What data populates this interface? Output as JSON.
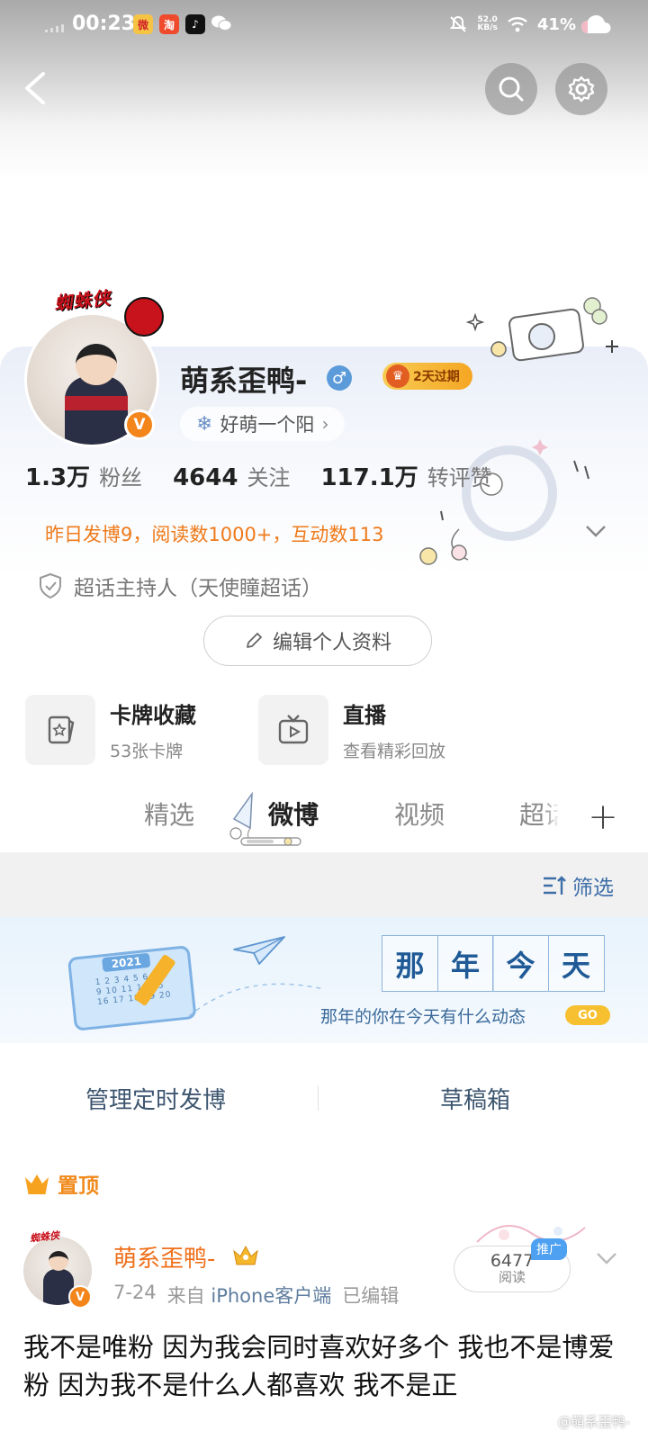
{
  "status_bar": {
    "time": "00:23",
    "net_speed_value": "52.0",
    "net_speed_unit": "KB/s",
    "battery": "41%"
  },
  "profile": {
    "name": "萌系歪鸭-",
    "vip_tag": "2天过期",
    "fan_group": "好萌一个阳",
    "avatar_banner": "蜘蛛侠",
    "verified_badge": "V",
    "stats": [
      {
        "value": "1.3万",
        "label": "粉丝"
      },
      {
        "value": "4644",
        "label": "关注"
      },
      {
        "value": "117.1万",
        "label": "转评赞"
      }
    ],
    "yesterday_summary": "昨日发博9，阅读数1000+，互动数113",
    "supertopic_host": "超话主持人（天使瞳超话）",
    "edit_button": "编辑个人资料"
  },
  "features": [
    {
      "title": "卡牌收藏",
      "subtitle": "53张卡牌",
      "icon": "card-icon"
    },
    {
      "title": "直播",
      "subtitle": "查看精彩回放",
      "icon": "tv-icon"
    }
  ],
  "tabs": [
    "精选",
    "微博",
    "视频",
    "超话"
  ],
  "active_tab": "微博",
  "filter": {
    "label": "筛选"
  },
  "memory_banner": {
    "title_chars": [
      "那",
      "年",
      "今",
      "天"
    ],
    "subtitle": "那年的你在今天有什么动态",
    "go": "GO",
    "calendar_year": "2021"
  },
  "manage": {
    "scheduled": "管理定时发博",
    "drafts": "草稿箱"
  },
  "post": {
    "pinned_label": "置顶",
    "author": "萌系歪鸭-",
    "date": "7-24",
    "source_prefix": "来自",
    "source": "iPhone客户端",
    "edited": "已编辑",
    "reads": "6477",
    "reads_label": "阅读",
    "promo_label": "推广",
    "text": "我不是唯粉 因为我会同时喜欢好多个 我也不是博爱粉 因为我不是什么人都喜欢 我不是正",
    "watermark": "@萌系歪鸭-"
  },
  "colors": {
    "accent_orange": "#ef7a1a",
    "link_blue": "#3d6ea8",
    "verified_orange": "#f3851b",
    "gender_blue": "#5b9bd9"
  }
}
